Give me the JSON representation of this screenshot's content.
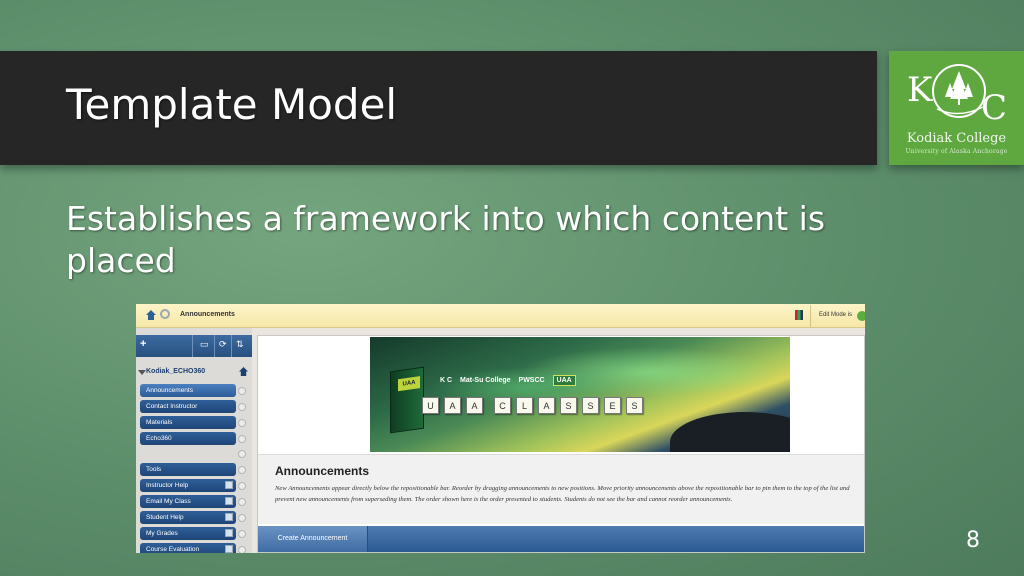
{
  "slide": {
    "title": "Template Model",
    "subtitle": "Establishes a framework into which content is placed",
    "page_number": "8"
  },
  "logo": {
    "initial_k": "K",
    "initial_c": "C",
    "college_name": "Kodiak College",
    "tagline": "University of Alaska Anchorage"
  },
  "screenshot": {
    "breadcrumb": "Announcements",
    "edit_mode_label": "Edit Mode is",
    "course_name": "Kodiak_ECHO360",
    "menu_group1": [
      {
        "label": "Announcements"
      },
      {
        "label": "Contact Instructor"
      },
      {
        "label": "Materials"
      },
      {
        "label": "Echo360"
      }
    ],
    "menu_group2": [
      {
        "label": "Tools"
      },
      {
        "label": "Instructor Help"
      },
      {
        "label": "Email My Class"
      },
      {
        "label": "Student Help"
      },
      {
        "label": "My Grades"
      },
      {
        "label": "Course Evaluation"
      }
    ],
    "banner": {
      "book_label": "UAA",
      "logo1": "K C",
      "logo2": "Mat-Su College",
      "logo3": "PWSCC",
      "logo4": "UAA",
      "tiles": [
        "U",
        "A",
        "A",
        "C",
        "L",
        "A",
        "S",
        "S",
        "E",
        "S"
      ]
    },
    "announcements_title": "Announcements",
    "announcements_desc": "New Announcements appear directly below the repositionable bar. Reorder by dragging announcements to new positions. Move priority announcements above the repositionable bar to pin them to the top of the list and prevent new announcements from superseding them. The order shown here is the order presented to students. Students do not see the bar and cannot reorder announcements.",
    "create_button": "Create Announcement"
  }
}
